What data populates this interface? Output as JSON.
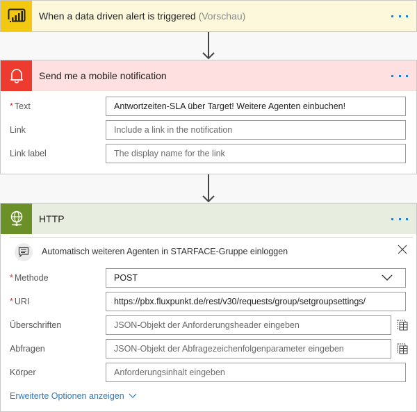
{
  "trigger": {
    "title": "When a data driven alert is triggered",
    "suffix": "(Vorschau)",
    "icon": "power-bi-icon",
    "more_label": "More options"
  },
  "notification": {
    "title": "Send me a mobile notification",
    "icon": "bell-icon",
    "fields": [
      {
        "label": "Text",
        "required": true,
        "value": "Antwortzeiten-SLA über Target! Weitere Agenten einbuchen!",
        "placeholder": ""
      },
      {
        "label": "Link",
        "required": false,
        "value": "",
        "placeholder": "Include a link in the notification"
      },
      {
        "label": "Link label",
        "required": false,
        "value": "",
        "placeholder": "The display name for the link"
      }
    ]
  },
  "http": {
    "title": "HTTP",
    "icon": "globe-icon",
    "comment": "Automatisch weiteren Agenten in STARFACE-Gruppe einloggen",
    "fields": [
      {
        "label": "Methode",
        "required": true,
        "value": "POST",
        "type": "select"
      },
      {
        "label": "URI",
        "required": true,
        "value": "https://pbx.fluxpunkt.de/rest/v30/requests/group/setgroupsettings/"
      },
      {
        "label": "Überschriften",
        "required": false,
        "value": "",
        "placeholder": "JSON-Objekt der Anforderungsheader eingeben"
      },
      {
        "label": "Abfragen",
        "required": false,
        "value": "",
        "placeholder": "JSON-Objekt der Abfragezeichenfolgenparameter eingeben"
      },
      {
        "label": "Körper",
        "required": false,
        "value": "",
        "placeholder": "Anforderungsinhalt eingeben"
      }
    ],
    "advanced_label": "Erweiterte Optionen anzeigen"
  },
  "required_marker": "*",
  "colors": {
    "trigger_accent": "#f2c811",
    "notify_accent": "#ed3b30",
    "http_accent": "#6b9028",
    "link": "#2a7ac2"
  }
}
